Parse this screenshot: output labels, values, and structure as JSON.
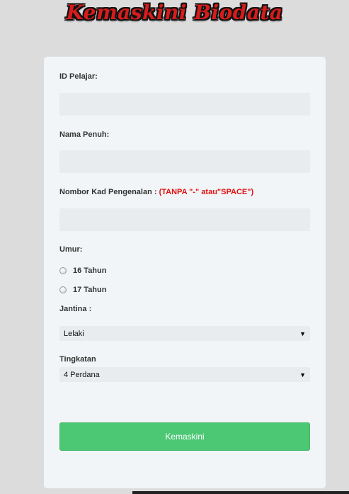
{
  "page_title": "Kemaskini Biodata",
  "form": {
    "id_label": "ID Pelajar:",
    "id_value": "",
    "name_label": "Nama Penuh:",
    "name_value": "",
    "ic_label": "Nombor Kad Pengenalan :",
    "ic_note": "(TANPA \"-\" atau\"SPACE\")",
    "ic_value": "",
    "age_label": "Umur:",
    "age_options": [
      "16 Tahun",
      "17 Tahun"
    ],
    "gender_label": "Jantina :",
    "gender_selected": "Lelaki",
    "level_label": "Tingkatan",
    "level_selected": "4 Perdana",
    "submit_label": "Kemaskini"
  },
  "colors": {
    "accent_button": "#4cc874",
    "note_red": "#e01010",
    "title_red": "#d61c1c"
  },
  "icons": {
    "select_caret": "▼"
  }
}
